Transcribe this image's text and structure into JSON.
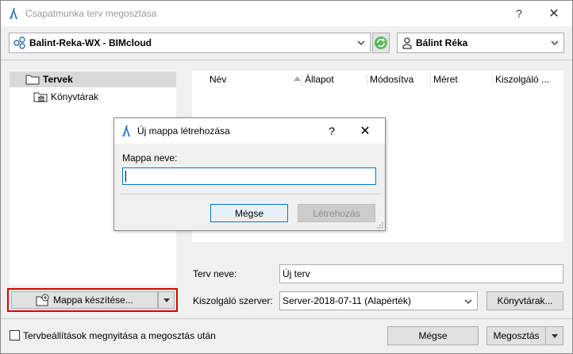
{
  "window": {
    "title": "Csapatmunka terv megosztása",
    "help": "?",
    "close": "✕"
  },
  "server_combo": {
    "value": "Balint-Reka-WX - BIMcloud"
  },
  "user_combo": {
    "value": "Bálint Réka"
  },
  "tree": {
    "items": [
      {
        "label": "Tervek"
      },
      {
        "label": "Könyvtárak"
      }
    ]
  },
  "list": {
    "columns": [
      "Név",
      "Állapot",
      "Módosítva",
      "Méret",
      "Kiszolgáló ..."
    ]
  },
  "create_button": {
    "label": "Mappa készítése..."
  },
  "form": {
    "name_label": "Terv neve:",
    "name_value": "Új terv",
    "server_label": "Kiszolgáló szerver:",
    "server_value": "Server-2018-07-11 (Alapérték)",
    "libraries_button": "Könyvtárak..."
  },
  "footer": {
    "checkbox_label": "Tervbeállítások megnyitása a megosztás után",
    "cancel": "Mégse",
    "share": "Megosztás"
  },
  "dialog": {
    "title": "Új mappa létrehozása",
    "help": "?",
    "close": "✕",
    "field_label": "Mappa neve:",
    "field_value": "",
    "cancel": "Mégse",
    "create": "Létrehozás"
  }
}
